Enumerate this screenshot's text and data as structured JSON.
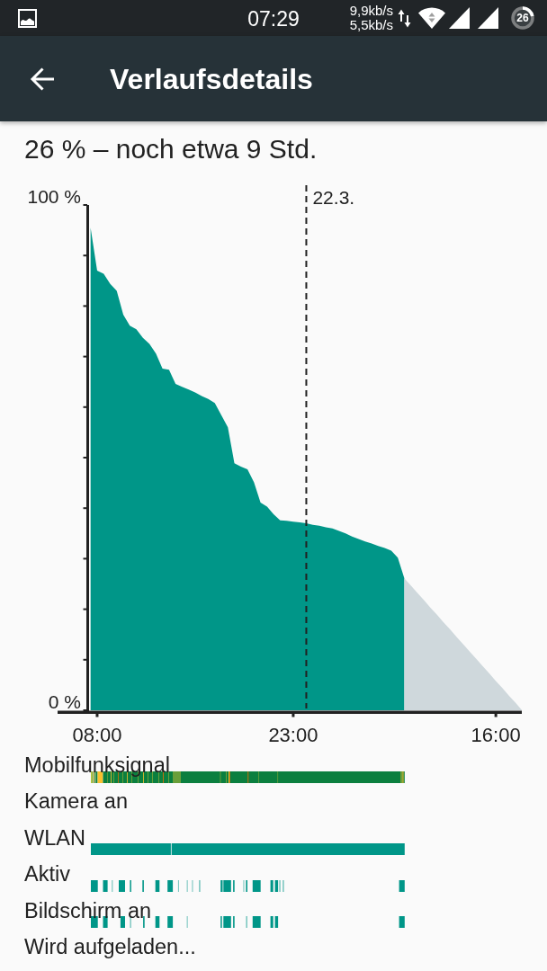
{
  "status_bar": {
    "time": "07:29",
    "network_speeds": [
      "9,9kb/s",
      "5,5kb/s"
    ],
    "battery_percent": "26"
  },
  "app_bar": {
    "title": "Verlaufsdetails"
  },
  "summary": "26 % – noch etwa 9 Std.",
  "chart": {
    "chart_data": {
      "type": "area",
      "stacked": false,
      "categories": [
        null,
        "08:00",
        null,
        null,
        null,
        null,
        null,
        null,
        null,
        null,
        null,
        null,
        null,
        null,
        null,
        null,
        null,
        null,
        null,
        null,
        null,
        null,
        null,
        null,
        null,
        null,
        null,
        null,
        null,
        null,
        null,
        "23:00",
        null,
        null,
        null,
        null,
        null,
        null,
        null,
        null,
        null,
        null,
        null,
        null,
        null,
        null,
        null,
        null,
        null,
        null,
        null,
        null,
        null,
        null,
        null,
        null,
        null,
        null,
        null,
        null,
        null,
        null,
        "16:00",
        null,
        null,
        null,
        null
      ],
      "series": [
        {
          "color": "#009688",
          "values": [
            95.5,
            87.0,
            86.4,
            84.4,
            83.0,
            78.3,
            76.1,
            75.4,
            73.7,
            72.5,
            70.6,
            67.6,
            67.4,
            64.6,
            64.0,
            63.5,
            62.9,
            62.2,
            61.6,
            60.8,
            58.4,
            56.0,
            48.9,
            48.2,
            47.7,
            45.1,
            41.1,
            40.3,
            38.8,
            37.6,
            37.5,
            37.3,
            37.2,
            37.0,
            36.7,
            36.5,
            36.2,
            36.0,
            35.5,
            35.0,
            34.4,
            33.9,
            33.4,
            33.0,
            32.5,
            32.1,
            31.6,
            30.2,
            26.1,
            null,
            null,
            null,
            null,
            null,
            null,
            null,
            null,
            null,
            null,
            null,
            null,
            null,
            null,
            null,
            null,
            null,
            null
          ]
        },
        {
          "color": "#cfd8dc",
          "values": [
            null,
            null,
            null,
            null,
            null,
            null,
            null,
            null,
            null,
            null,
            null,
            null,
            null,
            null,
            null,
            null,
            null,
            null,
            null,
            null,
            null,
            null,
            null,
            null,
            null,
            null,
            null,
            null,
            null,
            null,
            null,
            null,
            null,
            null,
            null,
            null,
            null,
            null,
            null,
            null,
            null,
            null,
            null,
            null,
            null,
            null,
            null,
            null,
            26.1,
            24.7,
            23.2,
            21.8,
            20.3,
            18.9,
            17.4,
            16.0,
            14.5,
            13.1,
            11.6,
            10.2,
            8.7,
            7.3,
            5.8,
            4.4,
            2.9,
            1.5,
            0
          ]
        }
      ],
      "ylim": [
        0,
        100
      ],
      "yticks": [
        {
          "value": 0,
          "label": "0 %"
        },
        {
          "value": 100,
          "label": "100 %"
        }
      ],
      "annotations": [
        "22.3."
      ]
    }
  },
  "timelines": [
    {
      "label": "Mobilfunksignal",
      "kind": "signal"
    },
    {
      "label": "Kamera an",
      "kind": "empty"
    },
    {
      "label": "WLAN",
      "kind": "wifi"
    },
    {
      "label": "Aktiv",
      "kind": "active"
    },
    {
      "label": "Bildschirm an",
      "kind": "screen"
    },
    {
      "label": "Wird aufgeladen...",
      "kind": "empty"
    }
  ]
}
